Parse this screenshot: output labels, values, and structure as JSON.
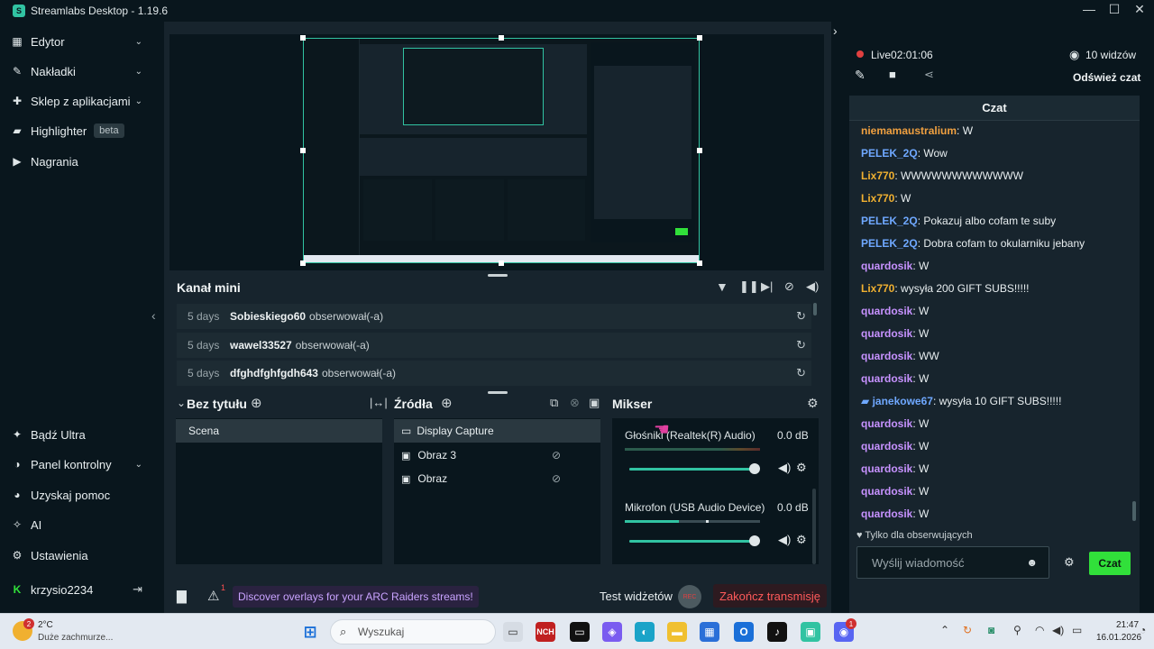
{
  "window": {
    "title": "Streamlabs Desktop - 1.19.6",
    "logo_letter": "S",
    "minimize": "—",
    "maximize": "☐",
    "close": "✕"
  },
  "sidebar": {
    "items": [
      {
        "label": "Edytor",
        "icon": "editor-icon"
      },
      {
        "label": "Nakładki",
        "icon": "overlays-icon"
      },
      {
        "label": "Sklep z aplikacjami",
        "icon": "app-store-icon"
      },
      {
        "label": "Highlighter",
        "icon": "highlighter-icon",
        "badge": "beta"
      },
      {
        "label": "Nagrania",
        "icon": "recordings-icon"
      }
    ],
    "bottom_items": [
      {
        "label": "Bądź Ultra",
        "icon": "ultra-icon"
      },
      {
        "label": "Panel kontrolny",
        "icon": "dashboard-icon"
      },
      {
        "label": "Uzyskaj pomoc",
        "icon": "help-icon"
      },
      {
        "label": "AI",
        "icon": "ai-icon"
      },
      {
        "label": "Ustawienia",
        "icon": "settings-icon"
      }
    ],
    "user": "krzysio2234"
  },
  "mini_feed": {
    "title": "Kanał mini",
    "events": [
      {
        "days": "5 days",
        "name": "Sobieskiego60",
        "action": "obserwował(-a)"
      },
      {
        "days": "5 days",
        "name": "wawel33527",
        "action": "obserwował(-a)"
      },
      {
        "days": "5 days",
        "name": "dfghdfghfgdh643",
        "action": "obserwował(-a)"
      }
    ]
  },
  "scenes": {
    "title": "Bez tytułu",
    "items": [
      "Scena"
    ]
  },
  "sources": {
    "title": "Źródła",
    "items": [
      "Display Capture",
      "Obraz 3",
      "Obraz"
    ]
  },
  "mixer": {
    "title": "Mikser",
    "channels": [
      {
        "name": "Głośniki (Realtek(R) Audio)",
        "level": "0.0 dB",
        "volume": 0.98
      },
      {
        "name": "Mikrofon (USB Audio Device)",
        "level": "0.0 dB",
        "volume": 0.98
      }
    ]
  },
  "bottom_bar": {
    "discover": "Discover overlays for your ARC Raiders streams!",
    "test_widgets": "Test widżetów",
    "rec": "REC",
    "end_stream": "Zakończ transmisję",
    "alert_count": "1"
  },
  "stream": {
    "live_label": "Live",
    "uptime": "02:01:06",
    "viewers": "10 widzów",
    "refresh_chat": "Odśwież czat"
  },
  "chat": {
    "title": "Czat",
    "messages": [
      {
        "user": "niemamaustralium",
        "text": ": W",
        "color": "#f0a040"
      },
      {
        "user": "PELEK_2Q",
        "text": ": Wow",
        "color": "#6fa8ff"
      },
      {
        "user": "Lix770",
        "text": ": WWWWWWWWWWWW",
        "color": "#f0b030"
      },
      {
        "user": "Lix770",
        "text": ": W",
        "color": "#f0b030"
      },
      {
        "user": "PELEK_2Q",
        "text": ": Pokazuj albo cofam te suby",
        "color": "#6fa8ff"
      },
      {
        "user": "PELEK_2Q",
        "text": ": Dobra cofam to okularniku jebany",
        "color": "#6fa8ff"
      },
      {
        "user": "quardosik",
        "text": ": W",
        "color": "#c792ff"
      },
      {
        "user": "Lix770",
        "text": ": wysyła 200 GIFT SUBS!!!!!",
        "color": "#f0b030"
      },
      {
        "user": "quardosik",
        "text": ": W",
        "color": "#c792ff"
      },
      {
        "user": "quardosik",
        "text": ": W",
        "color": "#c792ff"
      },
      {
        "user": "quardosik",
        "text": ": WW",
        "color": "#c792ff"
      },
      {
        "user": "quardosik",
        "text": ": W",
        "color": "#c792ff"
      },
      {
        "user": "janekowe67",
        "text": ": wysyła 10 GIFT SUBS!!!!!",
        "color": "#6fa8ff"
      },
      {
        "user": "quardosik",
        "text": ": W",
        "color": "#c792ff"
      },
      {
        "user": "quardosik",
        "text": ": W",
        "color": "#c792ff"
      },
      {
        "user": "quardosik",
        "text": ": W",
        "color": "#c792ff"
      },
      {
        "user": "quardosik",
        "text": ": W",
        "color": "#c792ff"
      },
      {
        "user": "quardosik",
        "text": ": W",
        "color": "#c792ff"
      }
    ],
    "followers_only": "Tylko dla obserwujących",
    "input_placeholder": "Wyślij wiadomość",
    "send_label": "Czat"
  },
  "taskbar": {
    "weather_temp": "2°C",
    "weather_desc": "Duże zachmurze...",
    "weather_badge": "2",
    "search_placeholder": "Wyszukaj",
    "time": "21:47",
    "date": "16.01.2026",
    "discord_badge": "1"
  },
  "colors": {
    "accent": "#31c3a2",
    "live": "#e04040",
    "send": "#31e03a"
  }
}
